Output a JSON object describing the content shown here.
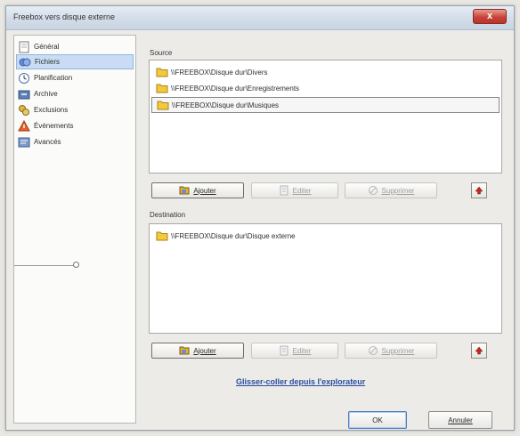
{
  "window": {
    "title": "Freebox vers disque externe",
    "close_label": "x"
  },
  "sidebar": {
    "items": [
      {
        "label": "Général",
        "icon": "general-icon",
        "selected": false
      },
      {
        "label": "Fichiers",
        "icon": "files-icon",
        "selected": true
      },
      {
        "label": "Planification",
        "icon": "schedule-icon",
        "selected": false
      },
      {
        "label": "Archive",
        "icon": "archive-icon",
        "selected": false
      },
      {
        "label": "Exclusions",
        "icon": "exclusions-icon",
        "selected": false
      },
      {
        "label": "Événements",
        "icon": "events-icon",
        "selected": false
      },
      {
        "label": "Avancés",
        "icon": "advanced-icon",
        "selected": false
      }
    ]
  },
  "source": {
    "label": "Source",
    "items": [
      {
        "path": "\\\\FREEBOX\\Disque dur\\Divers",
        "selected": false
      },
      {
        "path": "\\\\FREEBOX\\Disque dur\\Enregistrements",
        "selected": false
      },
      {
        "path": "\\\\FREEBOX\\Disque dur\\Musiques",
        "selected": true
      }
    ],
    "add_label": "Ajouter",
    "edit_label": "Editer",
    "delete_label": "Supprimer"
  },
  "destination": {
    "label": "Destination",
    "items": [
      {
        "path": "\\\\FREEBOX\\Disque dur\\Disque externe",
        "selected": false
      }
    ],
    "add_label": "Ajouter",
    "edit_label": "Editer",
    "delete_label": "Supprimer"
  },
  "drag_link": "Glisser-coller depuis l'explorateur",
  "footer": {
    "ok_label": "OK",
    "cancel_label": "Annuler"
  },
  "colors": {
    "selection": "#c9dcf3",
    "link": "#2a4ea0",
    "close": "#c9433a",
    "up_arrow": "#c0281f"
  }
}
